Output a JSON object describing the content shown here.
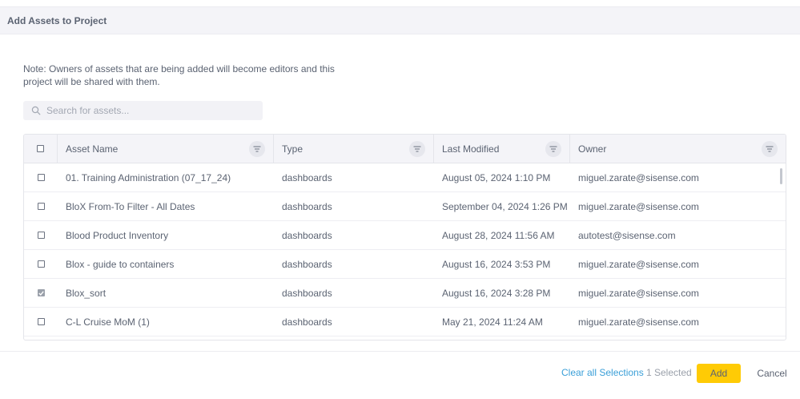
{
  "dialog": {
    "title": "Add Assets to Project",
    "note": "Note: Owners of assets that are being added will become editors and this project will be shared with them."
  },
  "search": {
    "placeholder": "Search for assets...",
    "value": "",
    "icon": "search-icon"
  },
  "table": {
    "columns": [
      {
        "label": "Asset Name"
      },
      {
        "label": "Type"
      },
      {
        "label": "Last Modified"
      },
      {
        "label": "Owner"
      }
    ],
    "rows": [
      {
        "checked": false,
        "name": "01. Training Administration (07_17_24)",
        "type": "dashboards",
        "modified": "August 05, 2024 1:10 PM",
        "owner": "miguel.zarate@sisense.com"
      },
      {
        "checked": false,
        "name": "BloX From-To Filter - All Dates",
        "type": "dashboards",
        "modified": "September 04, 2024 1:26 PM",
        "owner": "miguel.zarate@sisense.com"
      },
      {
        "checked": false,
        "name": "Blood Product Inventory",
        "type": "dashboards",
        "modified": "August 28, 2024 11:56 AM",
        "owner": "autotest@sisense.com"
      },
      {
        "checked": false,
        "name": "Blox - guide to containers",
        "type": "dashboards",
        "modified": "August 16, 2024 3:53 PM",
        "owner": "miguel.zarate@sisense.com"
      },
      {
        "checked": true,
        "name": "Blox_sort",
        "type": "dashboards",
        "modified": "August 16, 2024 3:28 PM",
        "owner": "miguel.zarate@sisense.com"
      },
      {
        "checked": false,
        "name": "C-L Cruise MoM (1)",
        "type": "dashboards",
        "modified": "May 21, 2024 11:24 AM",
        "owner": "miguel.zarate@sisense.com"
      }
    ]
  },
  "footer": {
    "clear_label": "Clear all Selections",
    "selected_label": "1 Selected",
    "add_label": "Add",
    "cancel_label": "Cancel"
  },
  "colors": {
    "accent": "#ffcb05",
    "link": "#3a9fd8",
    "text": "#5b6372"
  }
}
